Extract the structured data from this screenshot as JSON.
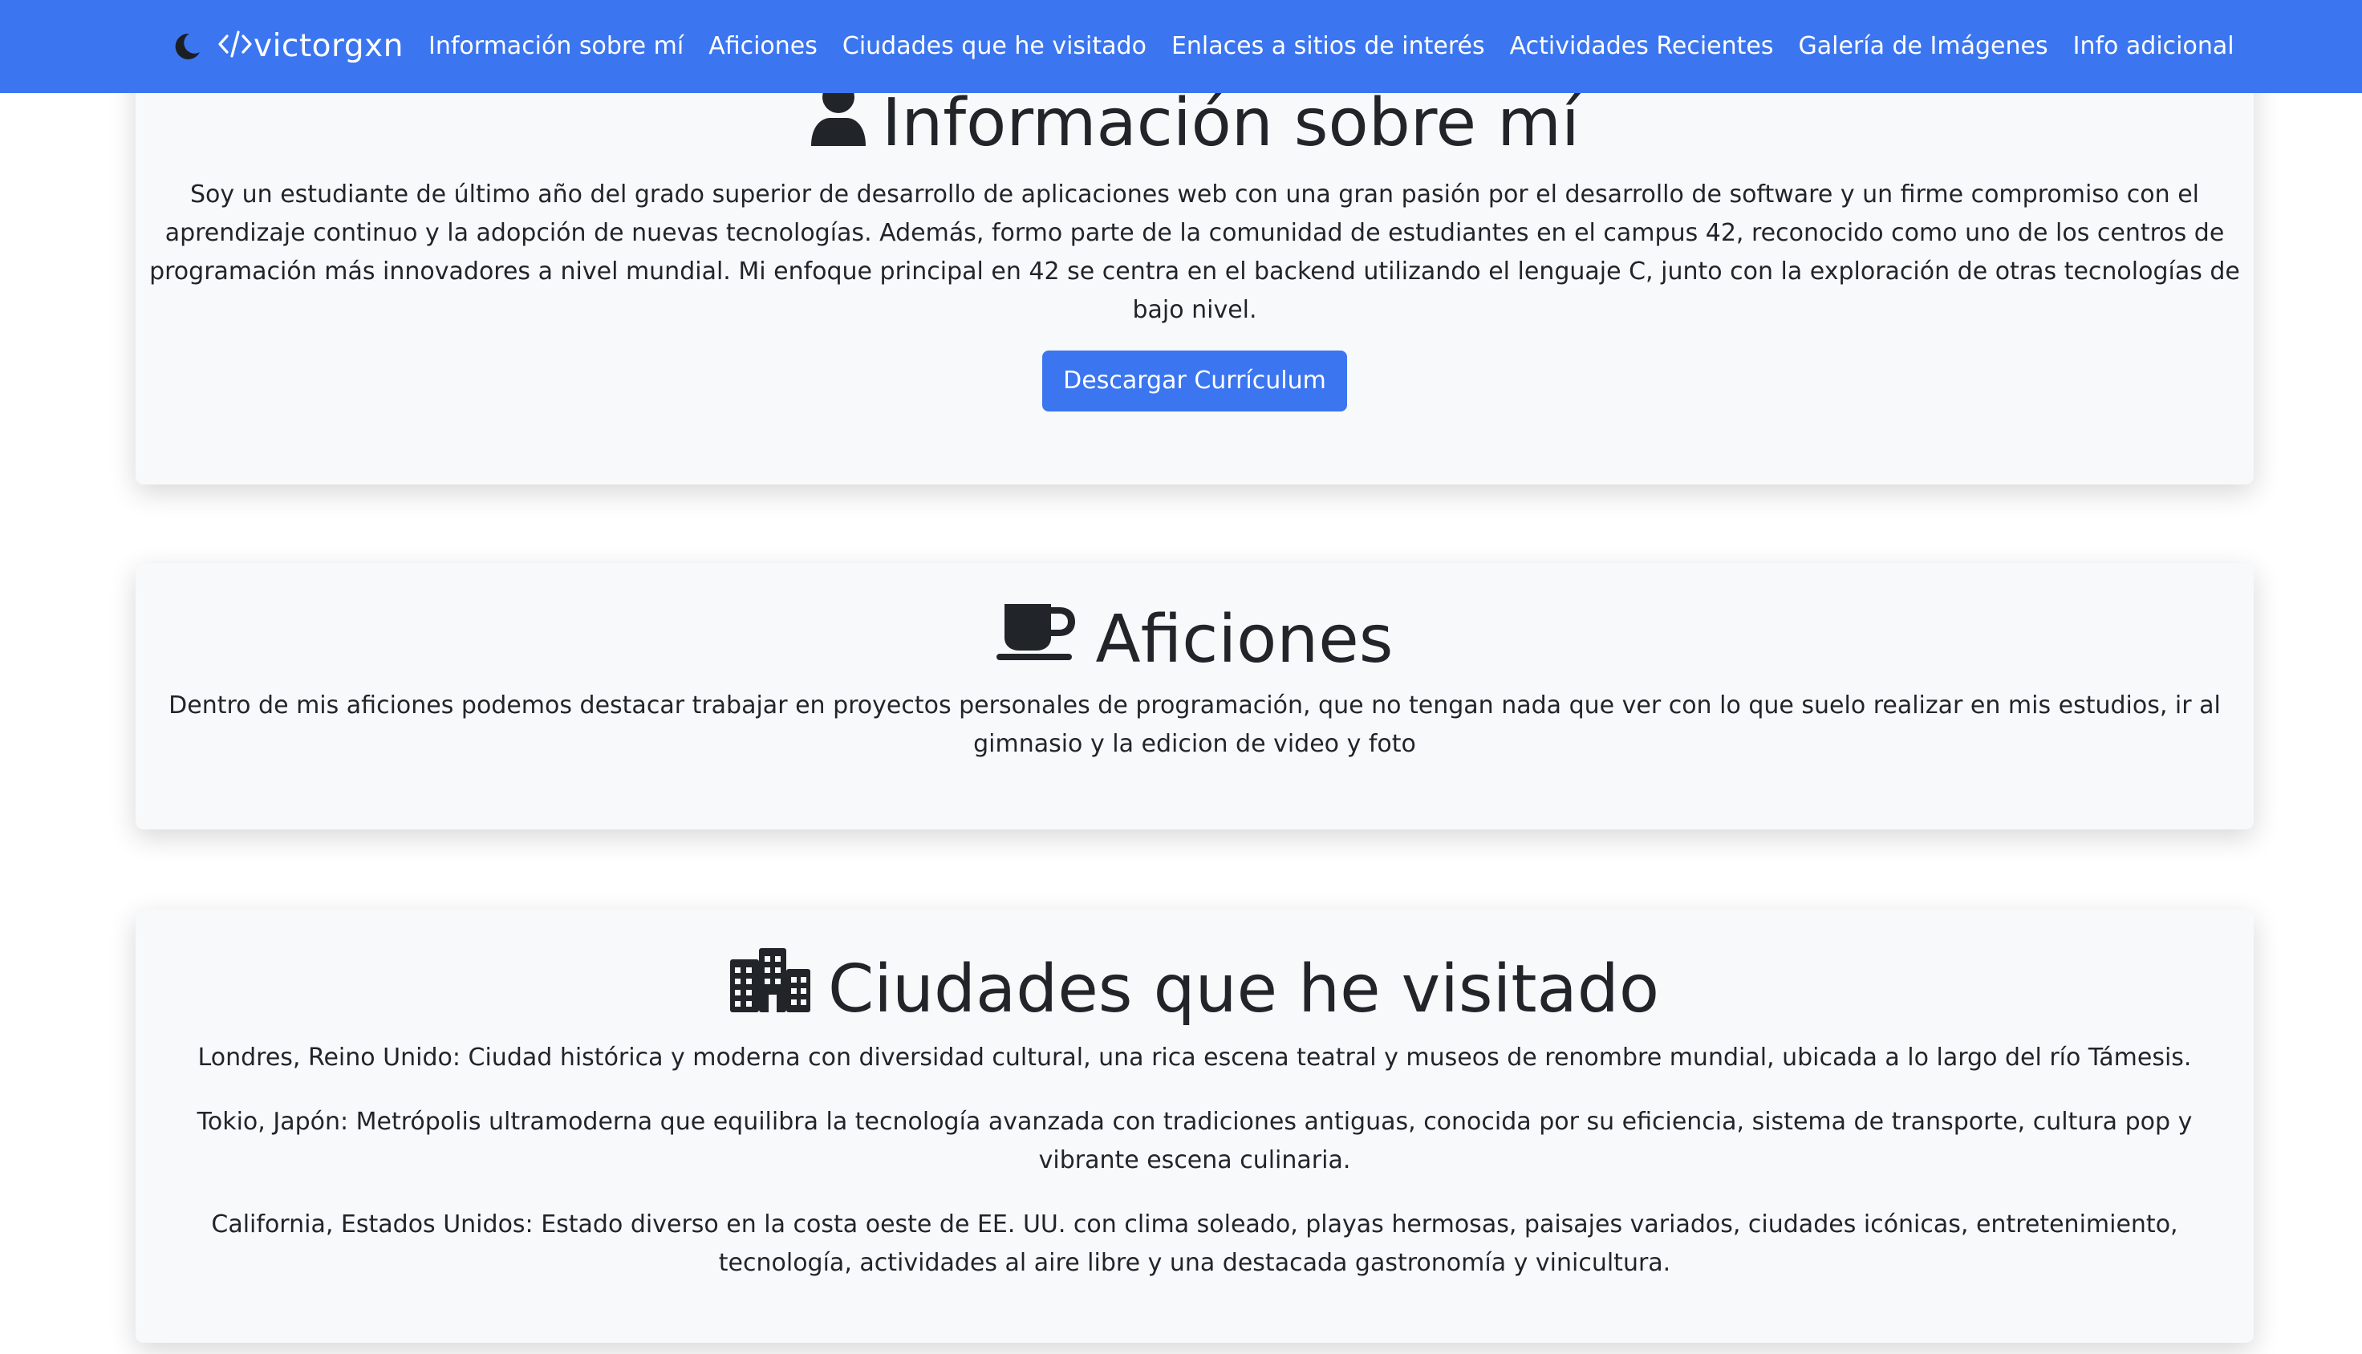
{
  "navbar": {
    "brand": "victorgxn",
    "links": [
      "Información sobre mí",
      "Aficiones",
      "Ciudades que he visitado",
      "Enlaces a sitios de interés",
      "Actividades Recientes",
      "Galería de Imágenes",
      "Info adicional"
    ],
    "icons": {
      "theme_toggle": "moon-icon",
      "logo": "code-icon"
    }
  },
  "about": {
    "title": "Información sobre mí",
    "icon": "user-icon",
    "text": "Soy un estudiante de último año del grado superior de desarrollo de aplicaciones web con una gran pasión por el desarrollo de software y un firme compromiso con el aprendizaje continuo y la adopción de nuevas tecnologías. Además, formo parte de la comunidad de estudiantes en el campus 42, reconocido como uno de los centros de programación más innovadores a nivel mundial. Mi enfoque principal en 42 se centra en el backend utilizando el lenguaje C, junto con la exploración de otras tecnologías de bajo nivel.",
    "button": "Descargar Currículum"
  },
  "hobbies": {
    "title": "Aficiones",
    "icon": "coffee-icon",
    "text": "Dentro de mis aficiones podemos destacar trabajar en proyectos personales de programación, que no tengan nada que ver con lo que suelo realizar en mis estudios, ir al gimnasio y la edicion de video y foto"
  },
  "cities": {
    "title": "Ciudades que he visitado",
    "icon": "city-icon",
    "items": [
      "Londres, Reino Unido: Ciudad histórica y moderna con diversidad cultural, una rica escena teatral y museos de renombre mundial, ubicada a lo largo del río Támesis.",
      "Tokio, Japón: Metrópolis ultramoderna que equilibra la tecnología avanzada con tradiciones antiguas, conocida por su eficiencia, sistema de transporte, cultura pop y vibrante escena culinaria.",
      "California, Estados Unidos: Estado diverso en la costa oeste de EE. UU. con clima soleado, playas hermosas, paisajes variados, ciudades icónicas, entretenimiento, tecnología, actividades al aire libre y una destacada gastronomía y vinicultura."
    ]
  },
  "colors": {
    "primary": "#3b76f0",
    "card_background": "#f8f9fa",
    "text": "#212529"
  }
}
